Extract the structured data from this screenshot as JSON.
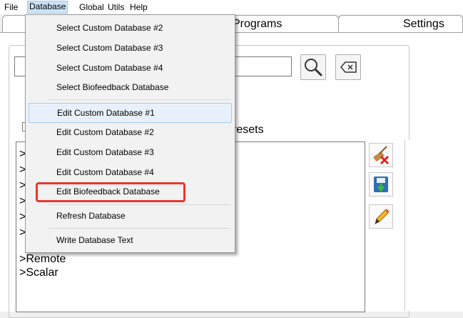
{
  "menubar": {
    "items": [
      {
        "label": "File"
      },
      {
        "label": "Database"
      },
      {
        "label": "Global"
      },
      {
        "label": "Utils"
      },
      {
        "label": "Help"
      }
    ]
  },
  "tabs": [
    {
      "label": "Programs"
    },
    {
      "label": "Settings"
    }
  ],
  "presets_label": "resets",
  "list": {
    "markers": [
      ">",
      ">",
      ">",
      ">",
      ">",
      ">"
    ],
    "items": [
      ">Remote",
      ">Scalar"
    ]
  },
  "database_menu": {
    "items": [
      {
        "label": "Select Custom Database #2"
      },
      {
        "label": "Select Custom Database #3"
      },
      {
        "label": "Select Custom Database #4"
      },
      {
        "label": "Select Biofeedback Database"
      },
      {
        "label": "Edit Custom Database #1"
      },
      {
        "label": "Edit Custom Database #2"
      },
      {
        "label": "Edit Custom Database #3"
      },
      {
        "label": "Edit Custom Database #4"
      },
      {
        "label": "Edit Biofeedback Database"
      },
      {
        "label": "Refresh Database"
      },
      {
        "label": "Write Database Text"
      }
    ]
  },
  "colors": {
    "menu_active_bg": "#cce4f7",
    "highlight_border": "#e8372f",
    "hover_bg": "#e8f1fb"
  }
}
